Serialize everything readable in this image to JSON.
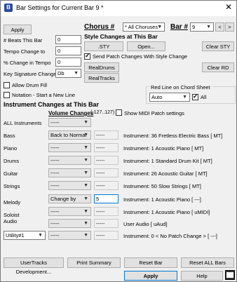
{
  "window": {
    "title": "Bar Settings for Current Bar 9 *",
    "close": "✕"
  },
  "apply_top": "Apply",
  "chorus": {
    "label": "Chorus #",
    "value": "* All Choruses *"
  },
  "bar": {
    "label": "Bar #",
    "value": "9",
    "prev": "<",
    "next": ">"
  },
  "left": {
    "beats_label": "# Beats This Bar",
    "beats_value": "0",
    "tempo_label": "Tempo Change to",
    "tempo_value": "0",
    "pct_tempo_label": "% Change in Tempo",
    "pct_tempo_value": "0",
    "key_label": "Key Signature Change to",
    "key_value": "Db",
    "drum_fill_label": "Allow Drum Fill",
    "notation_label": "Notation - Start a New Line"
  },
  "style": {
    "header": "Style Changes at This Bar",
    "sty_button": ".STY",
    "open_button": "Open...",
    "clear_sty_button": "Clear STY",
    "send_patch_label": "Send Patch Changes With Style Change",
    "realdrums_button": "RealDrums",
    "clear_rd_button": "Clear RD",
    "realtracks_button": "RealTracks"
  },
  "redline": {
    "label": "Red Line on Chord Sheet",
    "value": "Auto",
    "all_label": "All"
  },
  "instrument": {
    "header": "Instrument Changes at This Bar",
    "volume_label": "Volume Changes",
    "volume_range": "(-127..127)",
    "show_midi_label": "Show MIDI Patch settings",
    "rows": [
      {
        "name": "ALL Instruments",
        "volume": "-----",
        "patch": "",
        "desc": ""
      },
      {
        "name": "Bass",
        "volume": "Back to Normal",
        "patch": "-----",
        "desc": "Instrument: 36 Fretless Electric Bass [ MT]"
      },
      {
        "name": "Piano",
        "volume": "-----",
        "patch": "-----",
        "desc": "Instrument: 1 Acoustic Piano [ MT]"
      },
      {
        "name": "Drums",
        "volume": "-----",
        "patch": "-----",
        "desc": "Instrument: 1 Standard Drum Kit [ MT]"
      },
      {
        "name": "Guitar",
        "volume": "-----",
        "patch": "-----",
        "desc": "Instrument: 26 Acoustic Guitar [ MT]"
      },
      {
        "name": "Strings",
        "volume": "-----",
        "patch": "-----",
        "desc": "Instrument: 50 Slow Strings [ MT]"
      },
      {
        "name": "Melody",
        "volume": "Change by",
        "patch": "5",
        "desc": "Instrument: 1 Acoustic Piano [ ---]"
      },
      {
        "name": "Soloist",
        "volume": "-----",
        "patch": "-----",
        "desc": "Instrument: 1 Acoustic Piano [ uMIDI]"
      },
      {
        "name": "Audio",
        "volume": "-----",
        "patch": "-----",
        "desc": "User Audio [ uAud]"
      },
      {
        "name": "Utility#1",
        "volume": "-----",
        "patch": "-----",
        "desc": "Instrument: 0 < No Patch Change > [ ---]"
      }
    ]
  },
  "bottom": {
    "usertracks": "UserTracks Development...",
    "print_summary": "Print Summary",
    "reset_bar": "Reset Bar",
    "reset_all": "Reset ALL Bars",
    "apply": "Apply",
    "help": "Help"
  }
}
